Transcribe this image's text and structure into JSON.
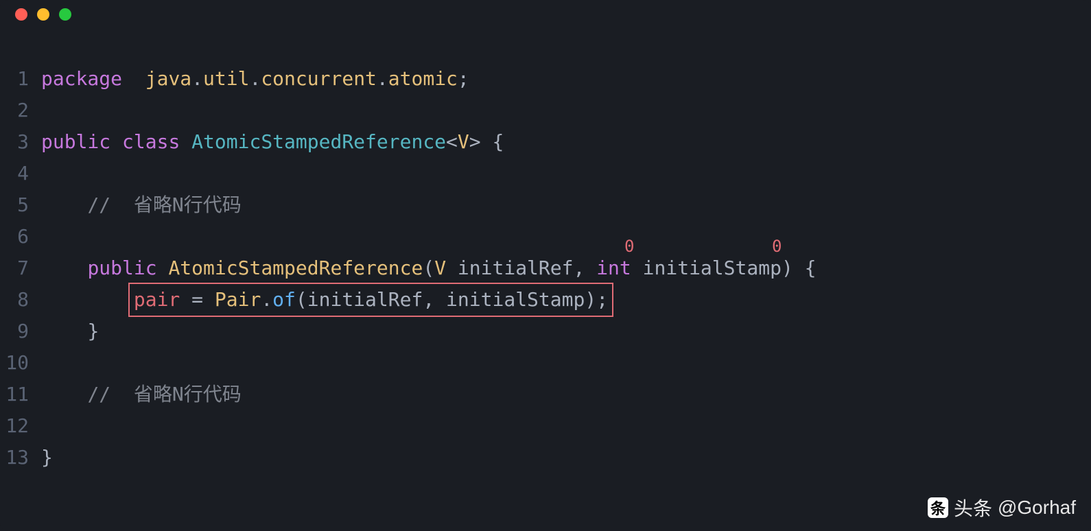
{
  "titlebar": {
    "buttons": [
      "close",
      "minimize",
      "maximize"
    ]
  },
  "code": {
    "lines": [
      {
        "n": "1",
        "indent": "",
        "tokens": [
          {
            "t": "package",
            "c": "kw"
          },
          {
            "t": "  ",
            "c": ""
          },
          {
            "t": "java",
            "c": "pkg-part"
          },
          {
            "t": ".",
            "c": "dot-sep"
          },
          {
            "t": "util",
            "c": "pkg-part"
          },
          {
            "t": ".",
            "c": "dot-sep"
          },
          {
            "t": "concurrent",
            "c": "pkg-part"
          },
          {
            "t": ".",
            "c": "dot-sep"
          },
          {
            "t": "atomic",
            "c": "pkg-part"
          },
          {
            "t": ";",
            "c": "semi"
          }
        ]
      },
      {
        "n": "2",
        "indent": "",
        "tokens": []
      },
      {
        "n": "3",
        "indent": "",
        "tokens": [
          {
            "t": "public",
            "c": "kw"
          },
          {
            "t": " ",
            "c": ""
          },
          {
            "t": "class",
            "c": "kw"
          },
          {
            "t": " ",
            "c": ""
          },
          {
            "t": "AtomicStampedReference",
            "c": "cls"
          },
          {
            "t": "<",
            "c": "generic"
          },
          {
            "t": "V",
            "c": "genv"
          },
          {
            "t": ">",
            "c": "generic"
          },
          {
            "t": " ",
            "c": ""
          },
          {
            "t": "{",
            "c": "brace"
          }
        ]
      },
      {
        "n": "4",
        "indent": "",
        "tokens": []
      },
      {
        "n": "5",
        "indent": "    ",
        "tokens": [
          {
            "t": "//  省略N行代码",
            "c": "comment"
          }
        ]
      },
      {
        "n": "6",
        "indent": "",
        "tokens": []
      },
      {
        "n": "7",
        "indent": "    ",
        "tokens": [
          {
            "t": "public",
            "c": "kw"
          },
          {
            "t": " ",
            "c": ""
          },
          {
            "t": "AtomicStampedReference",
            "c": "type"
          },
          {
            "t": "(",
            "c": "paren"
          },
          {
            "t": "V",
            "c": "genv"
          },
          {
            "t": " ",
            "c": ""
          },
          {
            "t": "initialRef",
            "c": "param"
          },
          {
            "t": ",",
            "c": "comma"
          },
          {
            "t": " ",
            "c": ""
          },
          {
            "t": "int",
            "c": "kw"
          },
          {
            "t": " ",
            "c": ""
          },
          {
            "t": "initialStamp",
            "c": "param"
          },
          {
            "t": ")",
            "c": "paren"
          },
          {
            "t": " ",
            "c": ""
          },
          {
            "t": "{",
            "c": "brace"
          }
        ]
      },
      {
        "n": "8",
        "indent": "        ",
        "tokens": [
          {
            "t": "pair",
            "c": "ident"
          },
          {
            "t": " ",
            "c": ""
          },
          {
            "t": "=",
            "c": "eq"
          },
          {
            "t": " ",
            "c": ""
          },
          {
            "t": "Pair",
            "c": "type"
          },
          {
            "t": ".",
            "c": "dot-sep"
          },
          {
            "t": "of",
            "c": "method"
          },
          {
            "t": "(",
            "c": "paren"
          },
          {
            "t": "initialRef",
            "c": "param"
          },
          {
            "t": ",",
            "c": "comma"
          },
          {
            "t": " ",
            "c": ""
          },
          {
            "t": "initialStamp",
            "c": "param"
          },
          {
            "t": ")",
            "c": "paren"
          },
          {
            "t": ";",
            "c": "semi"
          }
        ]
      },
      {
        "n": "9",
        "indent": "    ",
        "tokens": [
          {
            "t": "}",
            "c": "brace"
          }
        ]
      },
      {
        "n": "10",
        "indent": "",
        "tokens": []
      },
      {
        "n": "11",
        "indent": "    ",
        "tokens": [
          {
            "t": "//  省略N行代码",
            "c": "comment"
          }
        ]
      },
      {
        "n": "12",
        "indent": "",
        "tokens": []
      },
      {
        "n": "13",
        "indent": "",
        "tokens": [
          {
            "t": "}",
            "c": "brace"
          }
        ]
      }
    ]
  },
  "annotations": {
    "zero1": "0",
    "zero2": "0"
  },
  "highlight": {
    "line": 8
  },
  "watermark": {
    "prefix": "头条",
    "handle": "@Gorhaf"
  }
}
